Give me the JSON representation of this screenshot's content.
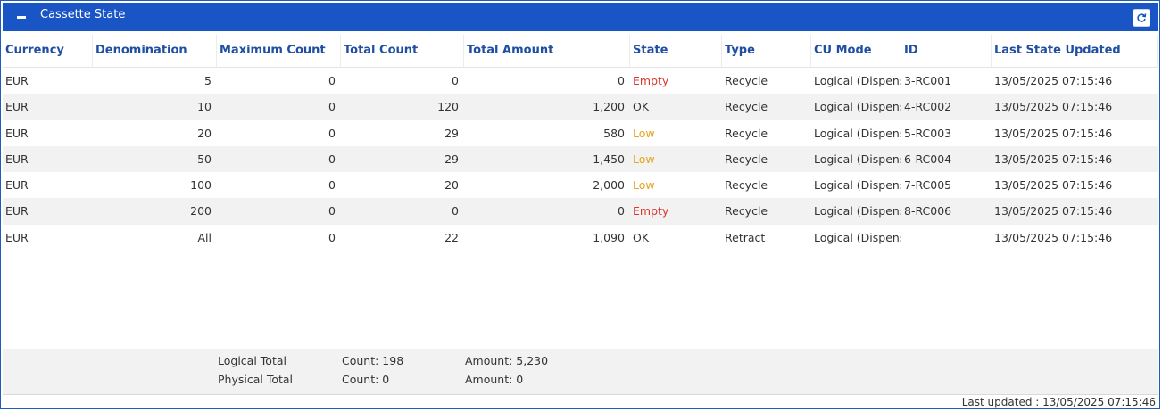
{
  "panel": {
    "title": "Cassette State",
    "collapse_icon": "minus-icon",
    "refresh_icon": "refresh-icon",
    "header_color": "#1a55c5"
  },
  "columns": [
    "Currency",
    "Denomination",
    "Maximum Count",
    "Total Count",
    "Total Amount",
    "State",
    "Type",
    "CU Mode",
    "ID",
    "Last State Updated"
  ],
  "rows": [
    {
      "currency": "EUR",
      "denomination": "5",
      "max_count": "0",
      "total_count": "0",
      "total_amount": "0",
      "state": "Empty",
      "type": "Recycle",
      "cu_mode": "Logical (Dispense)",
      "id": "3-RC001",
      "updated": "13/05/2025 07:15:46"
    },
    {
      "currency": "EUR",
      "denomination": "10",
      "max_count": "0",
      "total_count": "120",
      "total_amount": "1,200",
      "state": "OK",
      "type": "Recycle",
      "cu_mode": "Logical (Dispense)",
      "id": "4-RC002",
      "updated": "13/05/2025 07:15:46"
    },
    {
      "currency": "EUR",
      "denomination": "20",
      "max_count": "0",
      "total_count": "29",
      "total_amount": "580",
      "state": "Low",
      "type": "Recycle",
      "cu_mode": "Logical (Dispense)",
      "id": "5-RC003",
      "updated": "13/05/2025 07:15:46"
    },
    {
      "currency": "EUR",
      "denomination": "50",
      "max_count": "0",
      "total_count": "29",
      "total_amount": "1,450",
      "state": "Low",
      "type": "Recycle",
      "cu_mode": "Logical (Dispense)",
      "id": "6-RC004",
      "updated": "13/05/2025 07:15:46"
    },
    {
      "currency": "EUR",
      "denomination": "100",
      "max_count": "0",
      "total_count": "20",
      "total_amount": "2,000",
      "state": "Low",
      "type": "Recycle",
      "cu_mode": "Logical (Dispense)",
      "id": "7-RC005",
      "updated": "13/05/2025 07:15:46"
    },
    {
      "currency": "EUR",
      "denomination": "200",
      "max_count": "0",
      "total_count": "0",
      "total_amount": "0",
      "state": "Empty",
      "type": "Recycle",
      "cu_mode": "Logical (Dispense)",
      "id": "8-RC006",
      "updated": "13/05/2025 07:15:46"
    },
    {
      "currency": "EUR",
      "denomination": "All",
      "max_count": "0",
      "total_count": "22",
      "total_amount": "1,090",
      "state": "OK",
      "type": "Retract",
      "cu_mode": "Logical (Dispense)",
      "id": "",
      "updated": "13/05/2025 07:15:46"
    }
  ],
  "state_colors": {
    "Empty": "#d9372c",
    "Low": "#e3a51e",
    "OK": "#333333"
  },
  "totals": {
    "logical_label": "Logical Total",
    "logical_count": "Count: 198",
    "logical_amount": "Amount: 5,230",
    "physical_label": "Physical Total",
    "physical_count": "Count: 0",
    "physical_amount": "Amount: 0"
  },
  "last_updated": "Last updated : 13/05/2025 07:15:46"
}
